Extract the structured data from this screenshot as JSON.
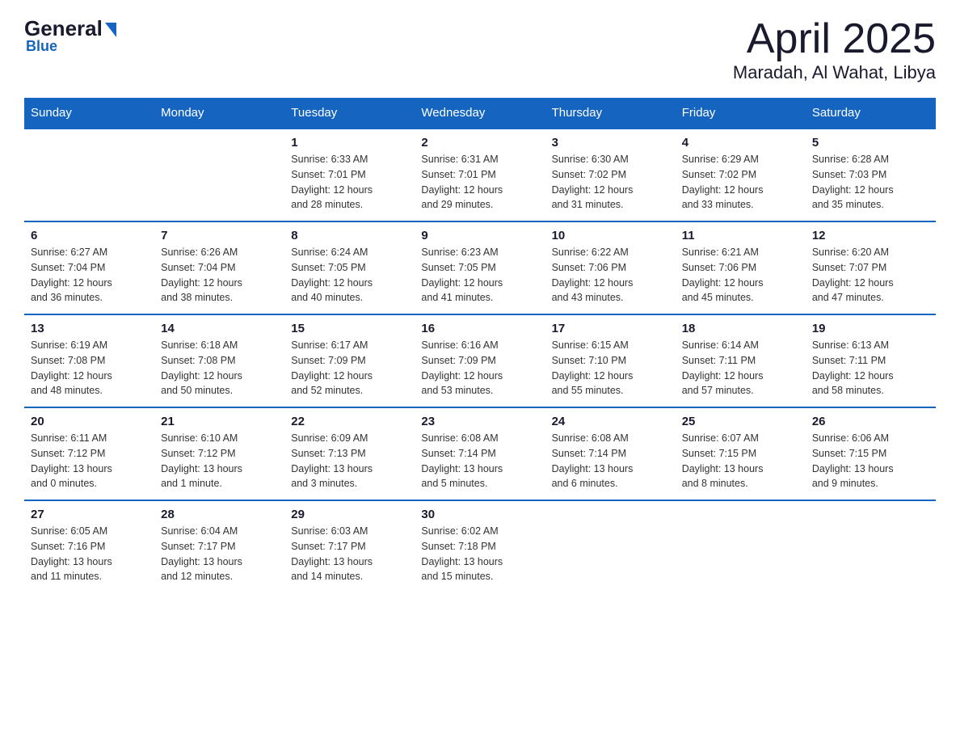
{
  "header": {
    "logo": {
      "general": "General",
      "blue": "Blue"
    },
    "month": "April 2025",
    "location": "Maradah, Al Wahat, Libya"
  },
  "weekdays": [
    "Sunday",
    "Monday",
    "Tuesday",
    "Wednesday",
    "Thursday",
    "Friday",
    "Saturday"
  ],
  "weeks": [
    [
      {
        "day": "",
        "info": ""
      },
      {
        "day": "",
        "info": ""
      },
      {
        "day": "1",
        "info": "Sunrise: 6:33 AM\nSunset: 7:01 PM\nDaylight: 12 hours\nand 28 minutes."
      },
      {
        "day": "2",
        "info": "Sunrise: 6:31 AM\nSunset: 7:01 PM\nDaylight: 12 hours\nand 29 minutes."
      },
      {
        "day": "3",
        "info": "Sunrise: 6:30 AM\nSunset: 7:02 PM\nDaylight: 12 hours\nand 31 minutes."
      },
      {
        "day": "4",
        "info": "Sunrise: 6:29 AM\nSunset: 7:02 PM\nDaylight: 12 hours\nand 33 minutes."
      },
      {
        "day": "5",
        "info": "Sunrise: 6:28 AM\nSunset: 7:03 PM\nDaylight: 12 hours\nand 35 minutes."
      }
    ],
    [
      {
        "day": "6",
        "info": "Sunrise: 6:27 AM\nSunset: 7:04 PM\nDaylight: 12 hours\nand 36 minutes."
      },
      {
        "day": "7",
        "info": "Sunrise: 6:26 AM\nSunset: 7:04 PM\nDaylight: 12 hours\nand 38 minutes."
      },
      {
        "day": "8",
        "info": "Sunrise: 6:24 AM\nSunset: 7:05 PM\nDaylight: 12 hours\nand 40 minutes."
      },
      {
        "day": "9",
        "info": "Sunrise: 6:23 AM\nSunset: 7:05 PM\nDaylight: 12 hours\nand 41 minutes."
      },
      {
        "day": "10",
        "info": "Sunrise: 6:22 AM\nSunset: 7:06 PM\nDaylight: 12 hours\nand 43 minutes."
      },
      {
        "day": "11",
        "info": "Sunrise: 6:21 AM\nSunset: 7:06 PM\nDaylight: 12 hours\nand 45 minutes."
      },
      {
        "day": "12",
        "info": "Sunrise: 6:20 AM\nSunset: 7:07 PM\nDaylight: 12 hours\nand 47 minutes."
      }
    ],
    [
      {
        "day": "13",
        "info": "Sunrise: 6:19 AM\nSunset: 7:08 PM\nDaylight: 12 hours\nand 48 minutes."
      },
      {
        "day": "14",
        "info": "Sunrise: 6:18 AM\nSunset: 7:08 PM\nDaylight: 12 hours\nand 50 minutes."
      },
      {
        "day": "15",
        "info": "Sunrise: 6:17 AM\nSunset: 7:09 PM\nDaylight: 12 hours\nand 52 minutes."
      },
      {
        "day": "16",
        "info": "Sunrise: 6:16 AM\nSunset: 7:09 PM\nDaylight: 12 hours\nand 53 minutes."
      },
      {
        "day": "17",
        "info": "Sunrise: 6:15 AM\nSunset: 7:10 PM\nDaylight: 12 hours\nand 55 minutes."
      },
      {
        "day": "18",
        "info": "Sunrise: 6:14 AM\nSunset: 7:11 PM\nDaylight: 12 hours\nand 57 minutes."
      },
      {
        "day": "19",
        "info": "Sunrise: 6:13 AM\nSunset: 7:11 PM\nDaylight: 12 hours\nand 58 minutes."
      }
    ],
    [
      {
        "day": "20",
        "info": "Sunrise: 6:11 AM\nSunset: 7:12 PM\nDaylight: 13 hours\nand 0 minutes."
      },
      {
        "day": "21",
        "info": "Sunrise: 6:10 AM\nSunset: 7:12 PM\nDaylight: 13 hours\nand 1 minute."
      },
      {
        "day": "22",
        "info": "Sunrise: 6:09 AM\nSunset: 7:13 PM\nDaylight: 13 hours\nand 3 minutes."
      },
      {
        "day": "23",
        "info": "Sunrise: 6:08 AM\nSunset: 7:14 PM\nDaylight: 13 hours\nand 5 minutes."
      },
      {
        "day": "24",
        "info": "Sunrise: 6:08 AM\nSunset: 7:14 PM\nDaylight: 13 hours\nand 6 minutes."
      },
      {
        "day": "25",
        "info": "Sunrise: 6:07 AM\nSunset: 7:15 PM\nDaylight: 13 hours\nand 8 minutes."
      },
      {
        "day": "26",
        "info": "Sunrise: 6:06 AM\nSunset: 7:15 PM\nDaylight: 13 hours\nand 9 minutes."
      }
    ],
    [
      {
        "day": "27",
        "info": "Sunrise: 6:05 AM\nSunset: 7:16 PM\nDaylight: 13 hours\nand 11 minutes."
      },
      {
        "day": "28",
        "info": "Sunrise: 6:04 AM\nSunset: 7:17 PM\nDaylight: 13 hours\nand 12 minutes."
      },
      {
        "day": "29",
        "info": "Sunrise: 6:03 AM\nSunset: 7:17 PM\nDaylight: 13 hours\nand 14 minutes."
      },
      {
        "day": "30",
        "info": "Sunrise: 6:02 AM\nSunset: 7:18 PM\nDaylight: 13 hours\nand 15 minutes."
      },
      {
        "day": "",
        "info": ""
      },
      {
        "day": "",
        "info": ""
      },
      {
        "day": "",
        "info": ""
      }
    ]
  ]
}
